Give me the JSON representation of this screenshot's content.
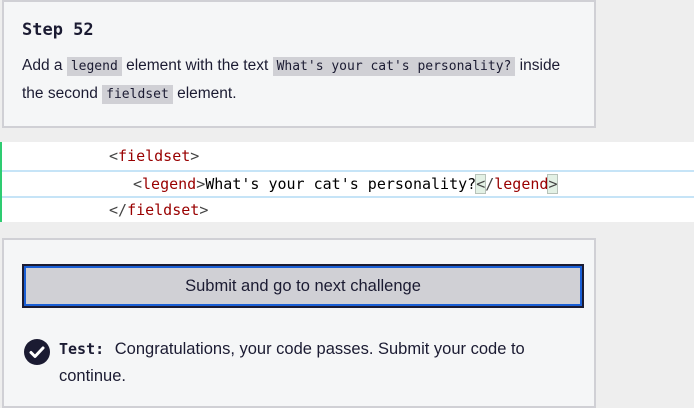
{
  "description": {
    "title": "Step 52",
    "parts": [
      "Add a ",
      "legend",
      " element with the text ",
      "What's your cat's personality?",
      " inside the second ",
      "fieldset",
      " element."
    ]
  },
  "editor": {
    "line1": {
      "open": "<",
      "tag": "fieldset",
      "close": ">"
    },
    "line2": {
      "open": "<",
      "tag": "legend",
      "close": ">",
      "text": "What's your cat's personality?",
      "end_open": "<",
      "end_slash": "/",
      "end_tag": "legend",
      "end_close": ">"
    },
    "line3": {
      "open": "</",
      "tag": "fieldset",
      "close": ">"
    }
  },
  "submit_label": "Submit and go to next challenge",
  "test": {
    "label": "Test:",
    "message": "Congratulations, your code passes. Submit your code to continue."
  },
  "colors": {
    "tag": "#990000",
    "accent": "#1a5fd6",
    "gutter": "#2ecc71"
  }
}
